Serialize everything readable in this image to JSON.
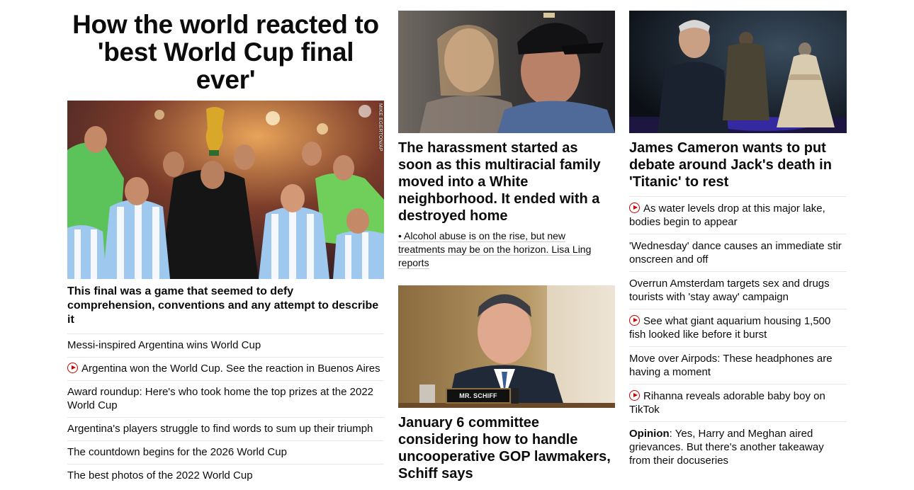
{
  "column1": {
    "headline": "How the world reacted to 'best World Cup final ever'",
    "image_credit": "MIKE EGERTON/AP",
    "subheadline": "This final was a game that seemed to defy comprehension, conventions and any attempt to describe it",
    "links": [
      {
        "text": "Messi-inspired Argentina wins World Cup",
        "video": false
      },
      {
        "text": "Argentina won the World Cup. See the reaction in Buenos Aires",
        "video": true
      },
      {
        "text": "Award roundup: Here's who took home the top prizes at the 2022 World Cup",
        "video": false
      },
      {
        "text": "Argentina's players struggle to find words to sum up their triumph",
        "video": false
      },
      {
        "text": "The countdown begins for the 2026 World Cup",
        "video": false
      },
      {
        "text": "The best photos of the 2022 World Cup",
        "video": false
      }
    ]
  },
  "column2": {
    "story1": {
      "headline": "The harassment started as soon as this multiracial family moved into a White neighborhood. It ended with a destroyed home",
      "bullet": "• Alcohol abuse is on the rise, but new treatments may be on the horizon. Lisa Ling reports"
    },
    "story2": {
      "nameplate": "MR. SCHIFF",
      "headline": "January 6 committee considering how to handle uncooperative GOP lawmakers, Schiff says"
    }
  },
  "column3": {
    "headline": "James Cameron wants to put debate around Jack's death in 'Titanic' to rest",
    "links": [
      {
        "text": "As water levels drop at this major lake, bodies begin to appear",
        "video": true
      },
      {
        "text": "'Wednesday' dance causes an immediate stir onscreen and off",
        "video": false
      },
      {
        "text": "Overrun Amsterdam targets sex and drugs tourists with 'stay away' campaign",
        "video": false
      },
      {
        "text": "See what giant aquarium housing 1,500 fish looked like before it burst",
        "video": true
      },
      {
        "text": "Move over Airpods: These headphones are having a moment",
        "video": false
      },
      {
        "text": "Rihanna reveals adorable baby boy on TikTok",
        "video": true
      }
    ],
    "opinion": {
      "label": "Opinion",
      "text": ": Yes, Harry and Meghan aired grievances. But there's another takeaway from their docuseries"
    }
  },
  "colors": {
    "text": "#0c0c0c",
    "video_icon": "#cc0000",
    "divider": "#e6e6e6"
  }
}
